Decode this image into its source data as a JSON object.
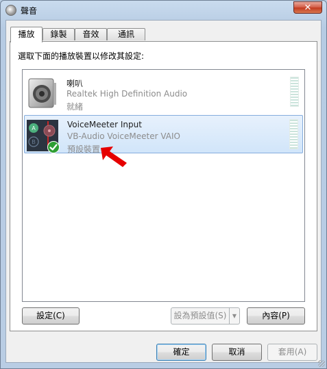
{
  "window": {
    "title": "聲音",
    "close_label": "✕"
  },
  "tabs": [
    {
      "label": "播放",
      "active": true
    },
    {
      "label": "錄製",
      "active": false
    },
    {
      "label": "音效",
      "active": false
    },
    {
      "label": "通訊",
      "active": false
    }
  ],
  "panel": {
    "instruction": "選取下面的播放裝置以修改其設定:"
  },
  "devices": [
    {
      "name": "喇叭",
      "description": "Realtek High Definition Audio",
      "status": "就緒",
      "icon": "speaker-icon",
      "selected": false
    },
    {
      "name": "VoiceMeeter Input",
      "description": "VB-Audio VoiceMeeter VAIO",
      "status": "預設裝置",
      "icon": "voicemeeter-icon",
      "selected": true,
      "default_badge": "checkmark-icon"
    }
  ],
  "buttons": {
    "configure": "設定(C)",
    "set_default": "設為預設值(S)",
    "set_default_arrow": "▼",
    "properties": "內容(P)",
    "ok": "確定",
    "cancel": "取消",
    "apply": "套用(A)"
  },
  "colors": {
    "annotation_arrow": "#e60000",
    "selection": "#d1e5fa",
    "meter": "#cbe4dc"
  }
}
